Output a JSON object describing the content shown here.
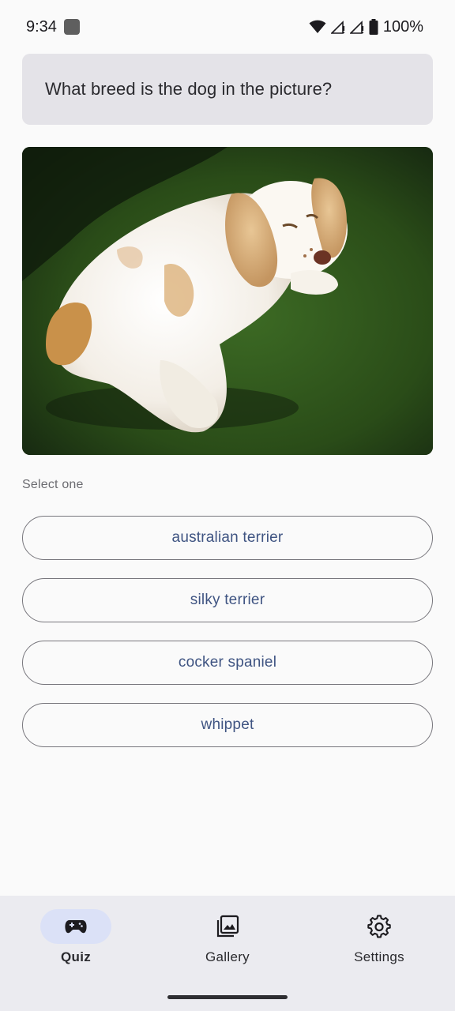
{
  "status_bar": {
    "time": "9:34",
    "battery": "100%",
    "icons": [
      "notification-square-icon",
      "wifi-icon",
      "signal-icon",
      "signal-icon",
      "battery-icon"
    ]
  },
  "question": "What breed is the dog in the picture?",
  "image": {
    "subject": "cocker spaniel lying on grass"
  },
  "select_label": "Select one",
  "options": [
    "australian terrier",
    "silky terrier",
    "cocker spaniel",
    "whippet"
  ],
  "nav": {
    "items": [
      {
        "label": "Quiz",
        "icon": "gamepad-icon",
        "active": true
      },
      {
        "label": "Gallery",
        "icon": "gallery-icon",
        "active": false
      },
      {
        "label": "Settings",
        "icon": "gear-icon",
        "active": false
      }
    ]
  },
  "colors": {
    "accent": "#3f5482",
    "active_pill": "#dbe1f7",
    "card_bg": "#e4e3e8",
    "nav_bg": "#ebebf0"
  }
}
